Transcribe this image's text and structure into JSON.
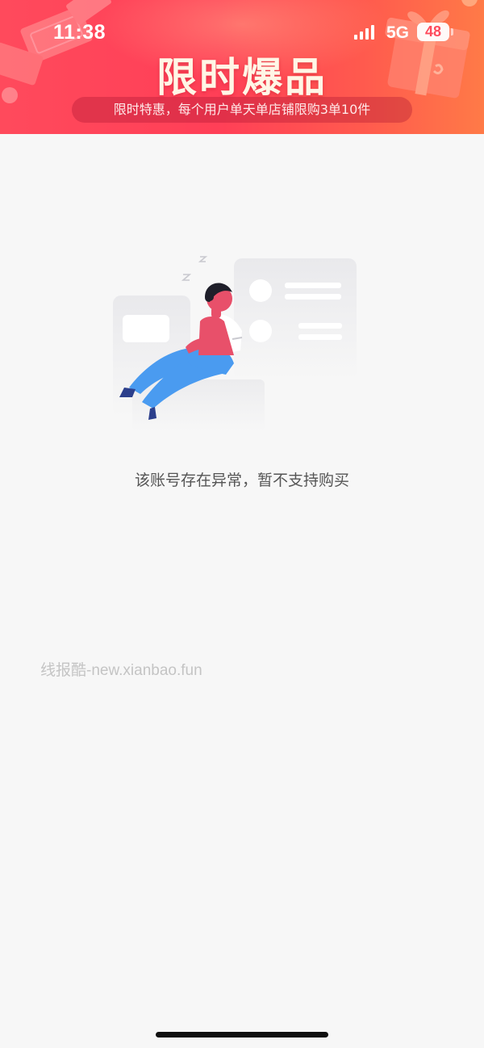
{
  "status_bar": {
    "time": "11:38",
    "network": "5G",
    "battery": "48"
  },
  "banner": {
    "title": "限时爆品",
    "subtitle": "限时特惠，每个用户单天单店铺限购3单10件"
  },
  "empty_state": {
    "message": "该账号存在异常，暂不支持购买"
  },
  "watermark": "线报酷-new.xianbao.fun",
  "colors": {
    "banner_gradient_start": "#ff4a5c",
    "banner_gradient_end": "#ff7a47",
    "page_background": "#f7f7f7",
    "illustration_pink": "#e8506a",
    "illustration_blue": "#4a9bf0"
  },
  "icons": {
    "signal": "signal-bars-icon",
    "gift": "gift-box-icon",
    "money": "money-bills-icon"
  }
}
